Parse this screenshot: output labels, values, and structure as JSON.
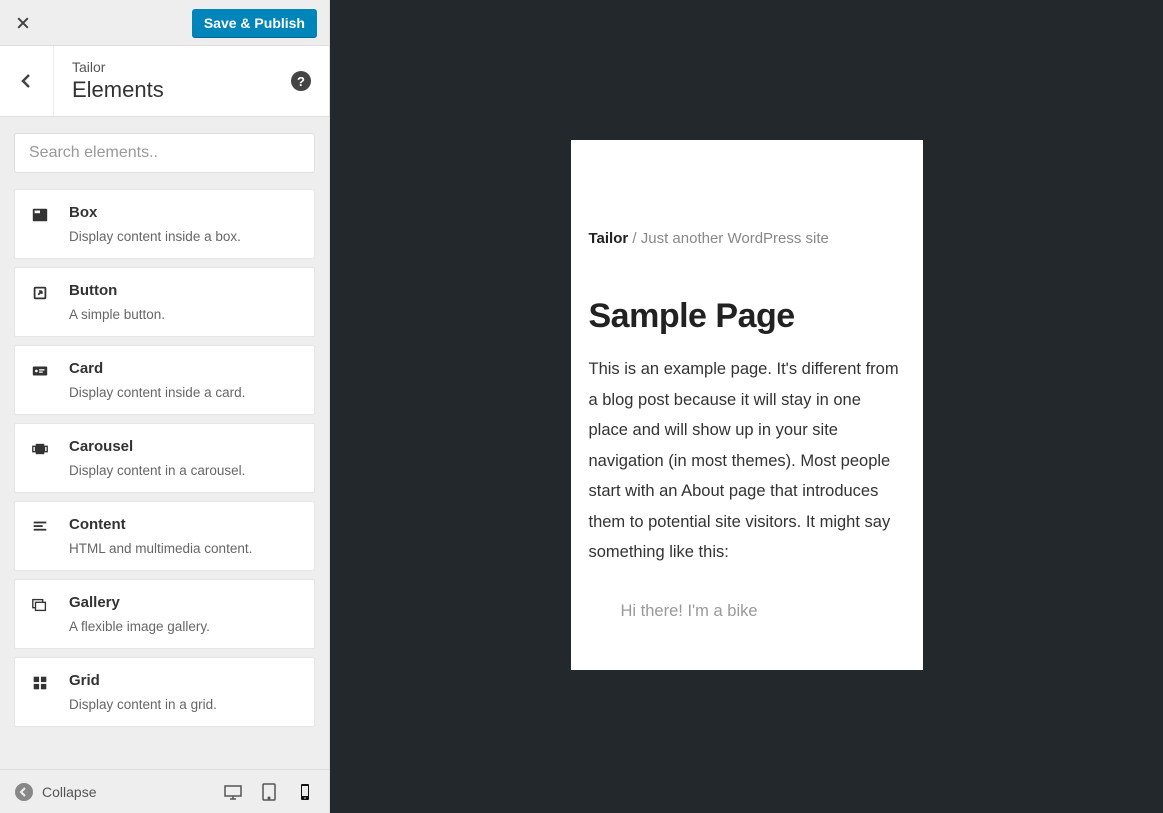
{
  "top": {
    "save_label": "Save & Publish"
  },
  "panel": {
    "subtitle": "Tailor",
    "title": "Elements",
    "help_label": "?"
  },
  "search": {
    "placeholder": "Search elements.."
  },
  "elements": [
    {
      "name": "Box",
      "desc": "Display content inside a box.",
      "icon": "box"
    },
    {
      "name": "Button",
      "desc": "A simple button.",
      "icon": "button"
    },
    {
      "name": "Card",
      "desc": "Display content inside a card.",
      "icon": "card"
    },
    {
      "name": "Carousel",
      "desc": "Display content in a carousel.",
      "icon": "carousel"
    },
    {
      "name": "Content",
      "desc": "HTML and multimedia content.",
      "icon": "content"
    },
    {
      "name": "Gallery",
      "desc": "A flexible image gallery.",
      "icon": "gallery"
    },
    {
      "name": "Grid",
      "desc": "Display content in a grid.",
      "icon": "grid"
    }
  ],
  "footer": {
    "collapse_label": "Collapse"
  },
  "preview": {
    "site_title": "Tailor",
    "site_tagline_sep": " / ",
    "site_tagline": "Just another WordPress site",
    "page_title": "Sample Page",
    "body": "This is an example page. It's different from a blog post because it will stay in one place and will show up in your site navigation (in most themes). Most people start with an About page that introduces them to potential site visitors. It might say something like this:",
    "quote": "Hi there! I'm a bike"
  }
}
